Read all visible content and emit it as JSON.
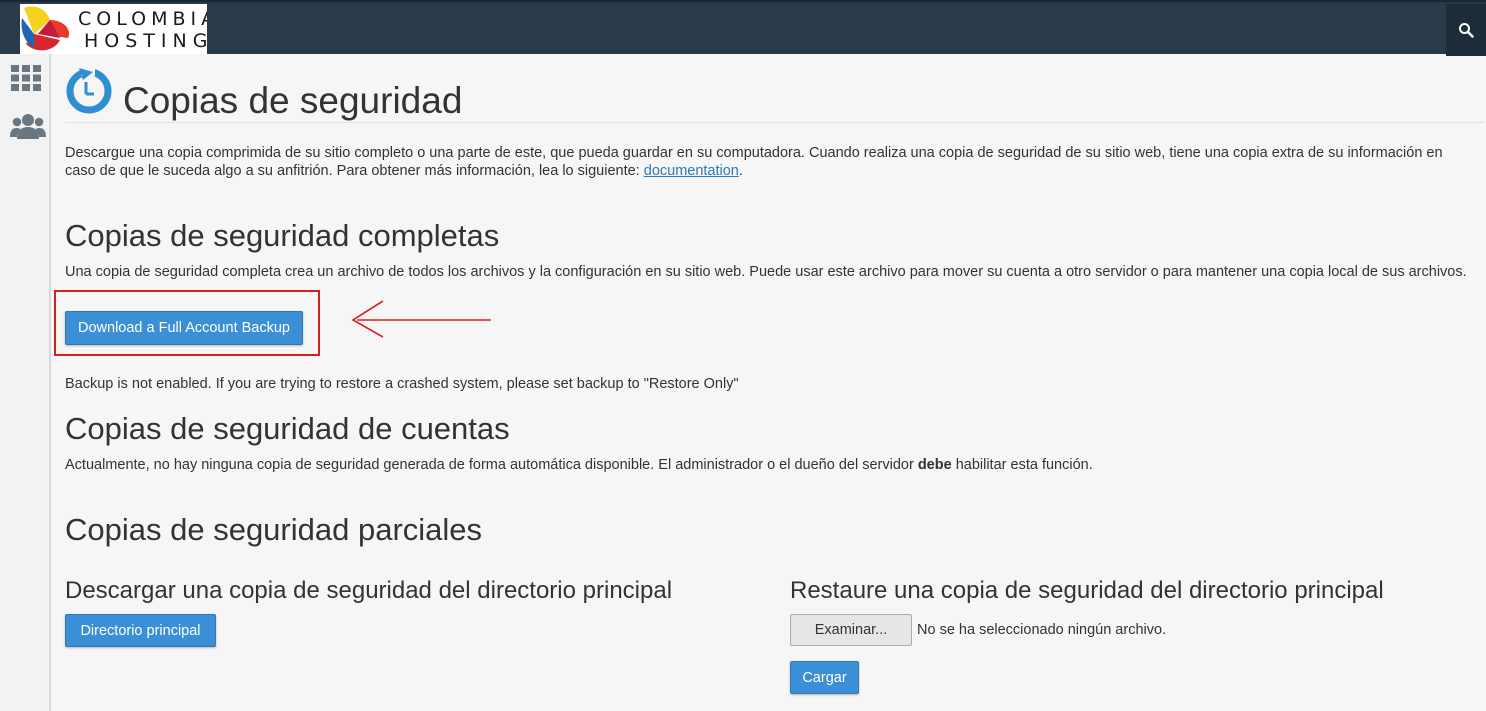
{
  "header": {
    "logo_line1": "COLOMBIA",
    "logo_line2": "HOSTING",
    "search_icon": "search-icon",
    "bg_color": "#293a4a"
  },
  "sidebar": {
    "items": [
      {
        "icon": "grid-icon"
      },
      {
        "icon": "users-icon"
      }
    ]
  },
  "page": {
    "title": "Copias de seguridad",
    "title_icon": "backup-clock-icon",
    "intro_text": "Descargue una copia comprimida de su sitio completo o una parte de este, que pueda guardar en su computadora. Cuando realiza una copia de seguridad de su sitio web, tiene una copia extra de su información en caso de que le suceda algo a su anfitrión. Para obtener más información, lea lo siguiente: ",
    "intro_link": "documentation",
    "intro_end": "."
  },
  "full_backup": {
    "heading": "Copias de seguridad completas",
    "description": "Una copia de seguridad completa crea un archivo de todos los archivos y la configuración en su sitio web. Puede usar este archivo para mover su cuenta a otro servidor o para mantener una copia local de sus archivos.",
    "button_label": "Download a Full Account Backup",
    "notice": "Backup is not enabled. If you are trying to restore a crashed system, please set backup to \"Restore Only\""
  },
  "account_backups": {
    "heading": "Copias de seguridad de cuentas",
    "text_before": "Actualmente, no hay ninguna copia de seguridad generada de forma automática disponible. El administrador o el dueño del servidor ",
    "text_bold": "debe",
    "text_after": " habilitar esta función."
  },
  "partial_backups": {
    "heading": "Copias de seguridad parciales",
    "download": {
      "heading": "Descargar una copia de seguridad del directorio principal",
      "button_label": "Directorio principal"
    },
    "restore": {
      "heading": "Restaure una copia de seguridad del directorio principal",
      "browse_label": "Examinar...",
      "no_file_text": "No se ha seleccionado ningún archivo.",
      "upload_label": "Cargar"
    }
  },
  "colors": {
    "primary_button": "#3b8fd6",
    "link": "#2a7ab8",
    "annotation_red": "#d22020"
  }
}
